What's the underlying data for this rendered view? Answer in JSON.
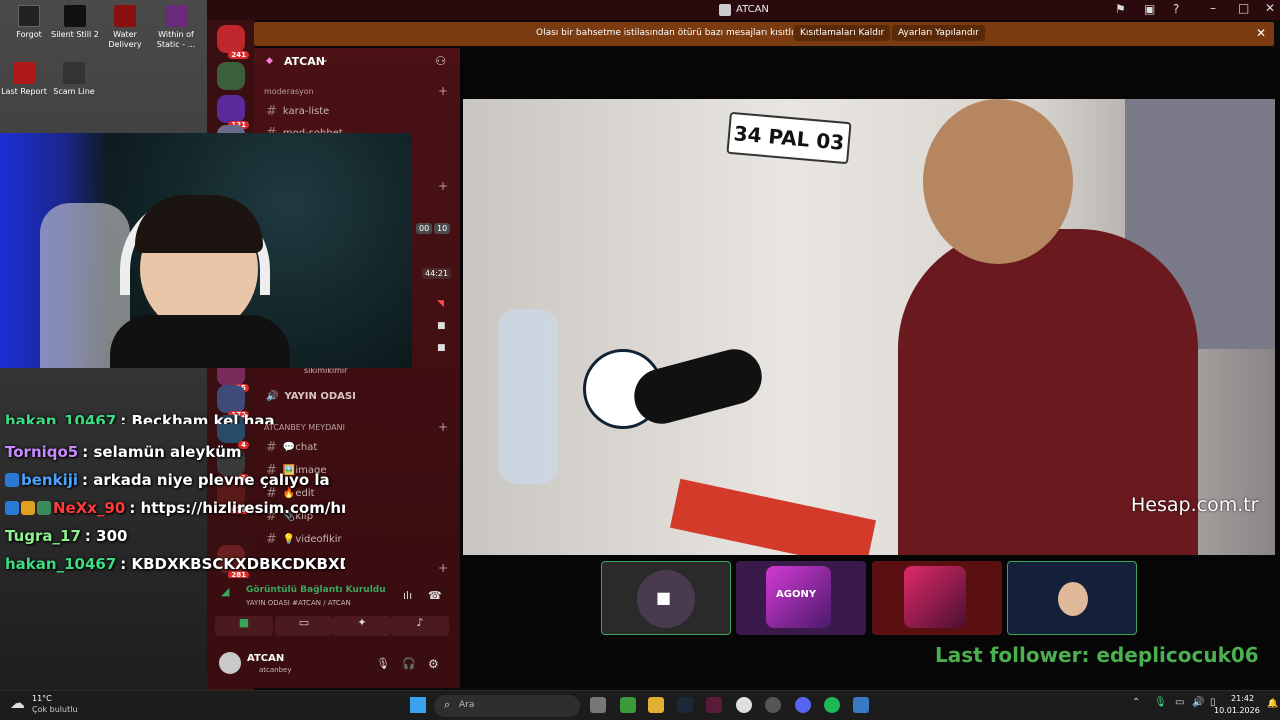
{
  "desktop": {
    "icons": [
      {
        "label": "Forgot"
      },
      {
        "label": "Silent Still 2"
      },
      {
        "label": "Water Delivery"
      },
      {
        "label": "Within of Static - ..."
      },
      {
        "label": "Last Report"
      },
      {
        "label": "Scam Line"
      }
    ]
  },
  "chat": {
    "lines": [
      {
        "user": "hakan_10467",
        "msg": ": Beckham kel haa",
        "color": "#3ddc84"
      },
      {
        "user": "Torniqo5",
        "msg": ": selamün aleyküm",
        "color": "#c78bff"
      },
      {
        "user": "benkiji",
        "msg": ": arkada niye plevne çalıyo la",
        "color": "#4aa3ff"
      },
      {
        "user": "NeXx_90",
        "msg": ": https://hizliresim.com/hmild",
        "color": "#ff3b3b"
      },
      {
        "user": "Tugra_17",
        "msg": ": 300",
        "color": "#8ff08f"
      },
      {
        "user": "hakan_10467",
        "msg": ": KBDXKBSCKXDBKCDKBXDKB",
        "color": "#3ddc84"
      }
    ]
  },
  "window": {
    "title": "ATCAN"
  },
  "banner": {
    "text": "Olası bir bahsetme istilasından ötürü bazı mesajları kısıtlıyoruz",
    "btn1": "Kısıtlamaları Kaldır",
    "btn2": "Ayarları Yapılandır"
  },
  "servers": [
    {
      "count": "241"
    },
    {
      "count": ""
    },
    {
      "count": "121"
    },
    {
      "count": ""
    },
    {
      "count": "95"
    },
    {
      "count": "172"
    },
    {
      "count": "4"
    },
    {
      "count": "1"
    },
    {
      "count": "478"
    },
    {
      "count": "281"
    }
  ],
  "guild": {
    "name": "ATCAN",
    "categories": [
      {
        "name": "moderasyon"
      },
      {
        "name": "ATCANBEY MEYDANI"
      }
    ],
    "channels_top": [
      {
        "name": "kara-liste"
      },
      {
        "name": "mod-sohbet"
      }
    ],
    "voice_user": "sikimikimir",
    "voice_channel": "YAYIN ODASI",
    "channels_bottom": [
      {
        "name": "💬chat"
      },
      {
        "name": "🖼️image"
      },
      {
        "name": "🔥edit"
      },
      {
        "name": "📎klip"
      },
      {
        "name": "💡videofikir"
      }
    ],
    "timers": [
      "00",
      "10",
      "44:21"
    ]
  },
  "voice_status": {
    "title": "Görüntülü Bağlantı Kuruldu",
    "subtitle": "YAYIN ODASI #ATCAN / ATCAN"
  },
  "user": {
    "name": "ATCAN",
    "status": "atcanbey"
  },
  "video": {
    "plate": "34 PAL 03",
    "watermark": "Hesap.com.tr",
    "overlay": "Last follower: edeplicocuk06",
    "thumb_label": "AGONY"
  },
  "taskbar": {
    "weather_temp": "11°C",
    "weather_desc": "Çok bulutlu",
    "search_placeholder": "Ara",
    "time": "21:42",
    "date": "10.01.2026"
  },
  "colors": {
    "discord_bg": "#3a0d10",
    "banner": "#7b3b10",
    "overlay_text": "#4caf50",
    "accent_green": "#3ba55c"
  }
}
